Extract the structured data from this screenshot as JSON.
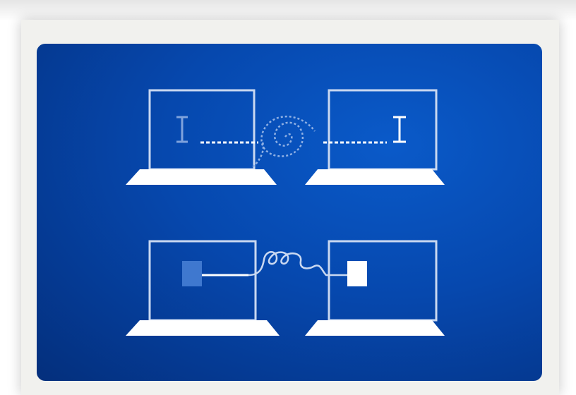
{
  "illustration": {
    "icons": [
      "laptop-icon",
      "text-cursor-icon",
      "dotted-connection-icon",
      "spiral-icon",
      "square-block-icon",
      "cable-loop-icon"
    ],
    "colors": {
      "panel_blue": "#0648ae",
      "panel_dark_blue": "#042f7c",
      "line_white": "#ffffff",
      "faded_white": "#8fb0e4",
      "card_background": "#f1f1ee"
    }
  }
}
